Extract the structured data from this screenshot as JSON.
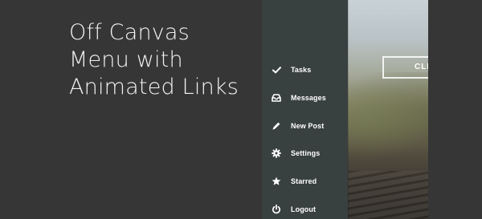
{
  "headline": {
    "line1": "Off Canvas",
    "line2": "Menu with",
    "line3": "Animated Links"
  },
  "menu": {
    "items": [
      {
        "label": "Tasks",
        "icon": "check-icon"
      },
      {
        "label": "Messages",
        "icon": "inbox-icon"
      },
      {
        "label": "New Post",
        "icon": "pencil-icon"
      },
      {
        "label": "Settings",
        "icon": "gear-icon"
      },
      {
        "label": "Starred",
        "icon": "star-icon"
      },
      {
        "label": "Logout",
        "icon": "power-icon"
      }
    ]
  },
  "content": {
    "cta_label": "CLICK"
  },
  "colors": {
    "background": "#363636",
    "menu_background": "#394040",
    "text": "#ffffff"
  }
}
